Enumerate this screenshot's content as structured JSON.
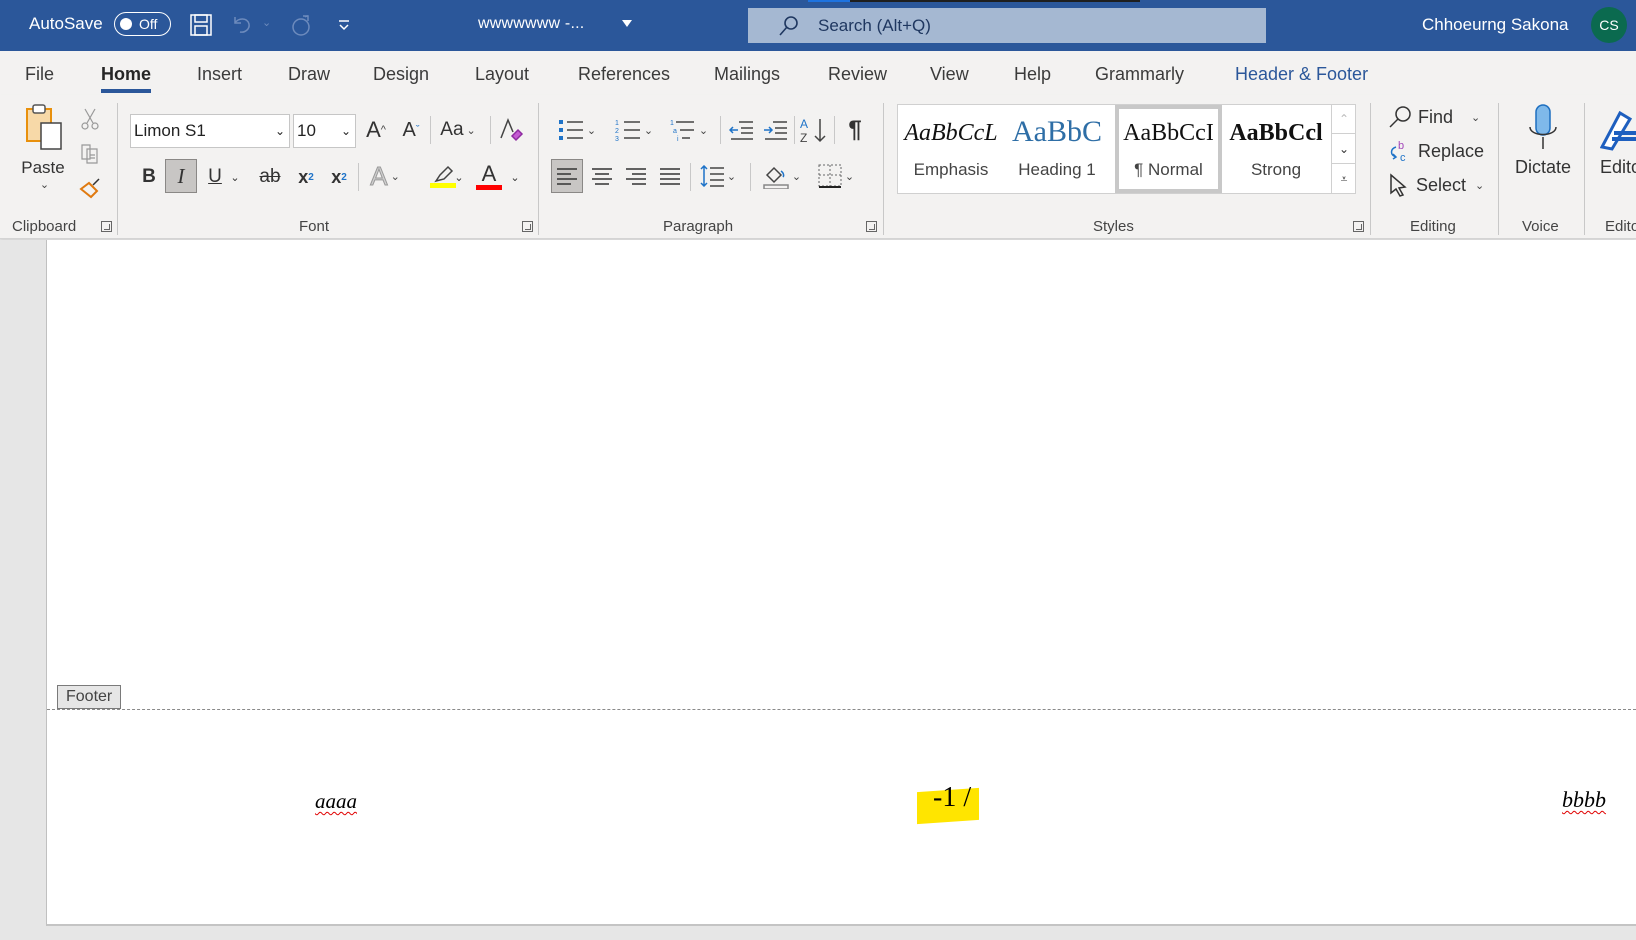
{
  "titlebar": {
    "autosave_label": "AutoSave",
    "autosave_state": "Off",
    "doc_title": "wwwwwww  -...",
    "search_placeholder": "Search (Alt+Q)",
    "user_name": "Chhoeurng Sakona",
    "user_initials": "CS",
    "accent_color": "#2b579a",
    "avatar_color": "#0b6a4f"
  },
  "tabs": [
    {
      "label": "File"
    },
    {
      "label": "Home",
      "active": true
    },
    {
      "label": "Insert"
    },
    {
      "label": "Draw"
    },
    {
      "label": "Design"
    },
    {
      "label": "Layout"
    },
    {
      "label": "References"
    },
    {
      "label": "Mailings"
    },
    {
      "label": "Review"
    },
    {
      "label": "View"
    },
    {
      "label": "Help"
    },
    {
      "label": "Grammarly"
    },
    {
      "label": "Header & Footer",
      "contextual": true
    }
  ],
  "ribbon": {
    "clipboard": {
      "label": "Clipboard",
      "paste_label": "Paste"
    },
    "font": {
      "label": "Font",
      "font_name": "Limon S1",
      "font_size": "10",
      "change_case_label": "Aa",
      "bold_label": "B",
      "italic_label": "I",
      "underline_label": "U",
      "strike_label": "ab",
      "subscript_label": "x",
      "subscript_mark": "2",
      "superscript_label": "x",
      "superscript_mark": "2",
      "highlight_color": "#ffff00",
      "font_color": "#ff0000"
    },
    "paragraph": {
      "label": "Paragraph",
      "pilcrow": "¶"
    },
    "styles": {
      "label": "Styles",
      "items": [
        {
          "sample": "AaBbCcL",
          "name": "Emphasis"
        },
        {
          "sample": "AaBbC",
          "name": "Heading 1"
        },
        {
          "sample": "AaBbCcI",
          "name": "¶ Normal",
          "selected": true
        },
        {
          "sample": "AaBbCcl",
          "name": "Strong"
        }
      ]
    },
    "editing": {
      "label": "Editing",
      "find": "Find",
      "replace": "Replace",
      "select": "Select"
    },
    "voice": {
      "label": "Voice",
      "dictate": "Dictate"
    },
    "editor": {
      "label": "Edito",
      "editor": "Edito"
    }
  },
  "document": {
    "footer_tag": "Footer",
    "footer_left": "aaaa",
    "footer_center": "-1 /",
    "footer_right": "bbbb"
  }
}
